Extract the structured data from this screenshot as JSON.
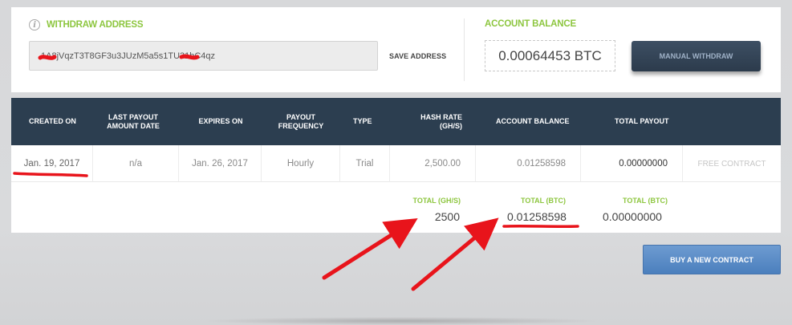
{
  "withdraw": {
    "title": "WITHDRAW ADDRESS",
    "address_value": "1A8jVqzT3T8GF3u3JUzM5a5s1TU31bC4qz",
    "save_label": "SAVE ADDRESS"
  },
  "balance": {
    "title": "ACCOUNT BALANCE",
    "value": "0.00064453 BTC",
    "withdraw_button": "MANUAL WITHDRAW"
  },
  "table": {
    "headers": [
      "CREATED ON",
      "LAST PAYOUT AMOUNT DATE",
      "EXPIRES ON",
      "PAYOUT FREQUENCY",
      "TYPE",
      "HASH RATE (GH/S)",
      "ACCOUNT BALANCE",
      "TOTAL PAYOUT"
    ],
    "row": {
      "created_on": "Jan. 19, 2017",
      "last_payout": "n/a",
      "expires_on": "Jan. 26, 2017",
      "frequency": "Hourly",
      "type": "Trial",
      "hash_rate": "2,500.00",
      "account_balance": "0.01258598",
      "total_payout": "0.00000000",
      "status": "FREE CONTRACT"
    },
    "totals": {
      "hash_label": "TOTAL (GH/S)",
      "hash_value": "2500",
      "balance_label": "TOTAL (BTC)",
      "balance_value": "0.01258598",
      "payout_label": "TOTAL (BTC)",
      "payout_value": "0.00000000"
    }
  },
  "buy_button": "BUY A NEW CONTRACT",
  "colors": {
    "accent_green": "#8dc63f",
    "header_navy": "#2c3e50",
    "annotation_red": "#e8141b",
    "buy_blue": "#5a8cc8"
  }
}
